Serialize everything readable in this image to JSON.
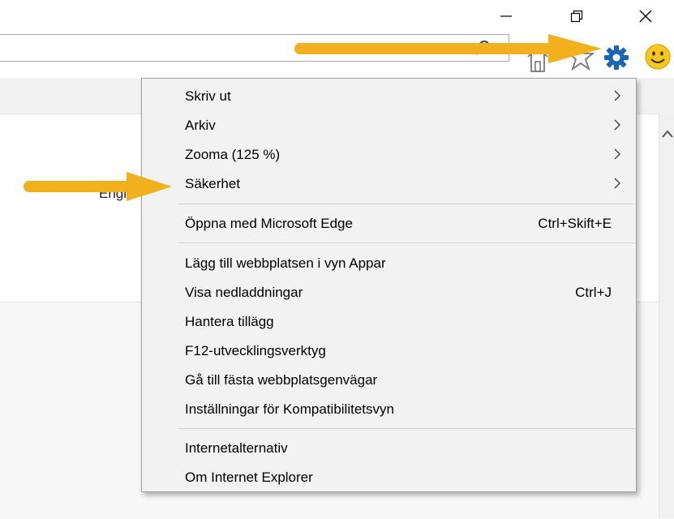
{
  "window": {
    "minimize_icon": "minimize-icon",
    "restore_icon": "restore-icon",
    "close_icon": "close-icon"
  },
  "toolbar": {
    "icons": [
      "search-icon",
      "chevron-down-icon",
      "home-icon",
      "star-icon",
      "gear-icon",
      "smiley-icon"
    ],
    "gear_color": "#1a66b3",
    "smiley_color": "#f7c81e"
  },
  "page": {
    "partial_text": "Engl"
  },
  "annotation": {
    "arrow_color": "#f2b01c"
  },
  "menu": {
    "items": [
      {
        "label": "Skriv ut",
        "shortcut": "",
        "submenu": true
      },
      {
        "label": "Arkiv",
        "shortcut": "",
        "submenu": true
      },
      {
        "label": "Zooma (125 %)",
        "shortcut": "",
        "submenu": true
      },
      {
        "label": "Säkerhet",
        "shortcut": "",
        "submenu": true
      },
      {
        "label": "Öppna med Microsoft Edge",
        "shortcut": "Ctrl+Skift+E",
        "submenu": false
      },
      {
        "label": "Lägg till webbplatsen i vyn Appar",
        "shortcut": "",
        "submenu": false
      },
      {
        "label": "Visa nedladdningar",
        "shortcut": "Ctrl+J",
        "submenu": false
      },
      {
        "label": "Hantera tillägg",
        "shortcut": "",
        "submenu": false
      },
      {
        "label": "F12-utvecklingsverktyg",
        "shortcut": "",
        "submenu": false
      },
      {
        "label": "Gå till fästa webbplatsgenvägar",
        "shortcut": "",
        "submenu": false
      },
      {
        "label": "Inställningar för Kompatibilitetsvyn",
        "shortcut": "",
        "submenu": false
      },
      {
        "label": "Internetalternativ",
        "shortcut": "",
        "submenu": false
      },
      {
        "label": "Om Internet Explorer",
        "shortcut": "",
        "submenu": false
      }
    ]
  }
}
